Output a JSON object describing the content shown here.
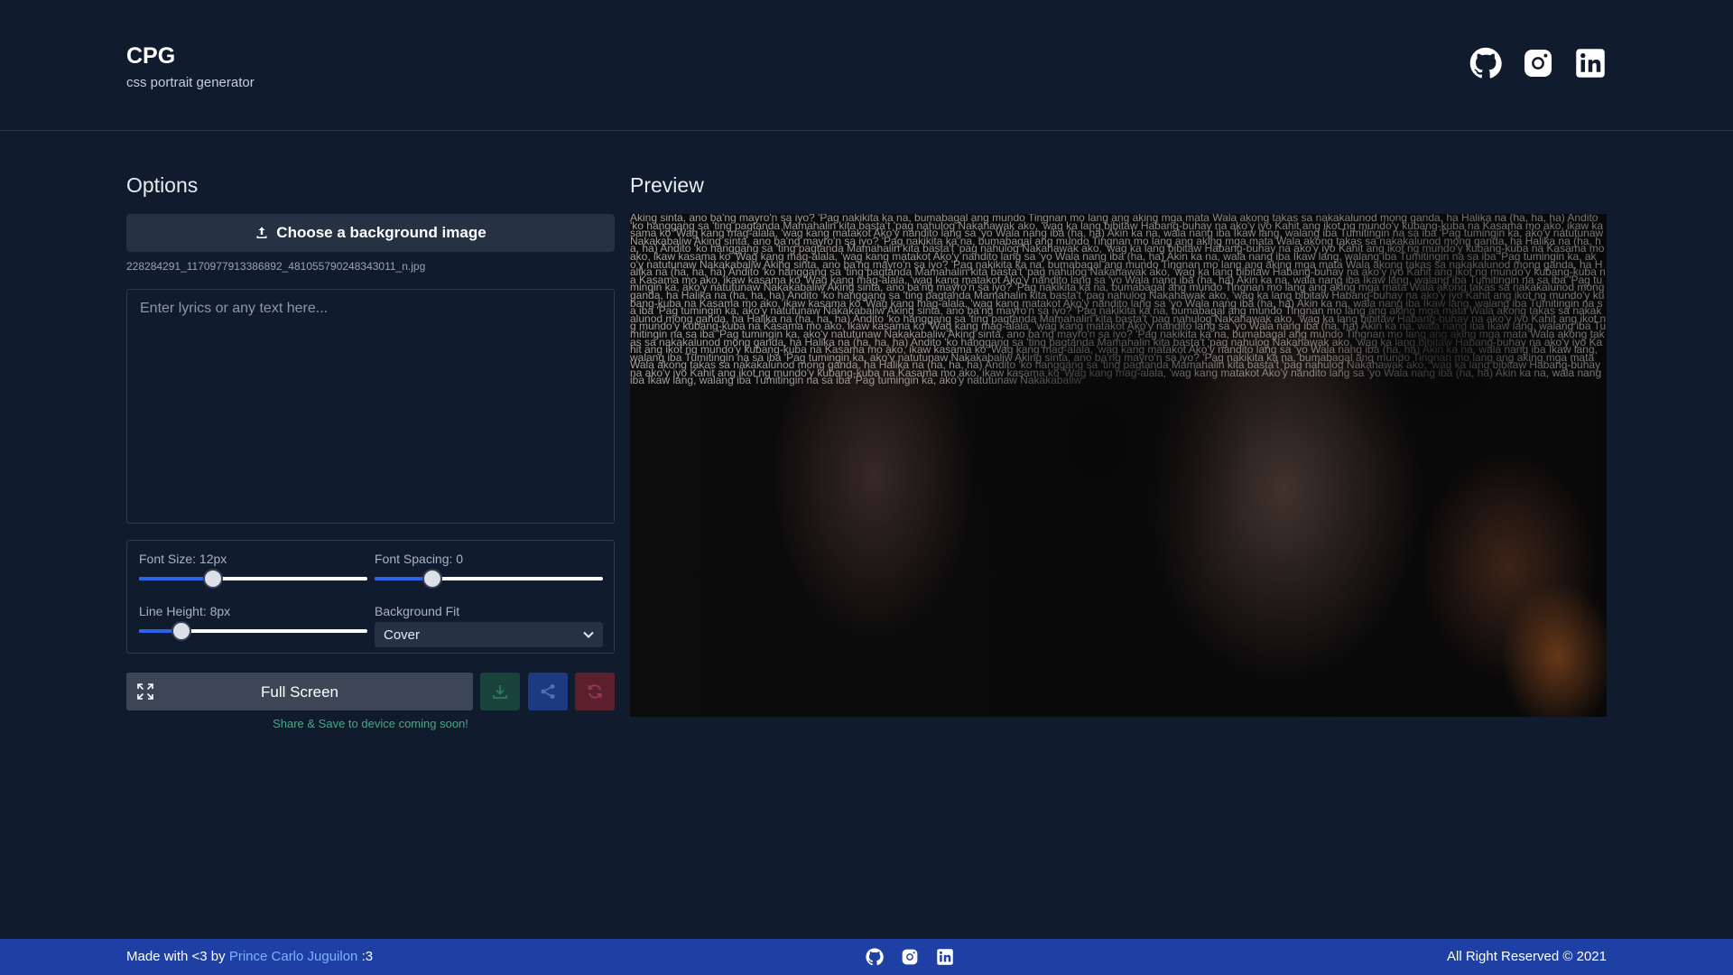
{
  "header": {
    "title": "CPG",
    "subtitle": "css portrait generator",
    "social_icons": [
      "github-icon",
      "instagram-icon",
      "linkedin-icon"
    ]
  },
  "options": {
    "section_title": "Options",
    "upload_label": "Choose a background image",
    "file_name": "228284291_1170977913386892_481055790248343011_n.jpg",
    "lyrics_placeholder": "Enter lyrics or any text here...",
    "lyrics_value": "",
    "font_size_label": "Font Size: 12px",
    "font_size_level": 0.32,
    "font_spacing_label": "Font Spacing: 0",
    "font_spacing_level": 0.25,
    "line_height_label": "Line Height: 8px",
    "line_height_level": 0.18,
    "background_fit_label": "Background Fit",
    "background_fit_value": "Cover",
    "fullscreen_label": "Full Screen",
    "coming_soon": "Share & Save to device coming soon!"
  },
  "preview": {
    "section_title": "Preview",
    "text": "Aking sinta, ano ba'ng mayro'n sa iyo? 'Pag nakikita ka na, bumabagal ang mundo Tingnan mo lang ang aking mga mata Wala akong takas sa nakakalunod mong ganda, ha Halika na (ha, ha, ha) Andito 'ko hanggang sa 'ting pagtanda Mamahalin kita basta't 'pag nahulog Nakahawak ako, 'wag ka lang bibitaw Habang-buhay na ako'y iyo Kahit ang ikot ng mundo'y kubang-kuba na Kasama mo ako, ikaw kasama ko 'Wag kang mag-alala, 'wag kang matakot Ako'y nandito lang sa 'yo Wala nang iba (ha, ha) Akin ka na, wala nang iba Ikaw lang, walang iba Tumitingin na sa iba 'Pag tumingin ka, ako'y natutunaw Nakakabaliw Aking sinta, ano ba'ng mayro'n sa iyo? 'Pag nakikita ka na, bumabagal ang mundo Tingnan mo lang ang aking mga mata Wala akong takas sa nakakalunod mong ganda, ha Halika na (ha, ha, ha) Andito 'ko hanggang sa 'ting pagtanda Mamahalin kita basta't 'pag nahulog Nakahawak ako, 'wag ka lang bibitaw Habang-buhay na ako'y iyo Kahit ang ikot ng mundo'y kubang-kuba na Kasama mo ako, ikaw kasama ko 'Wag kang mag-alala, 'wag kang matakot Ako'y nandito lang sa 'yo Wala nang iba (ha, ha) Akin ka na, wala nang iba Ikaw lang, walang iba Tumitingin na sa iba 'Pag tumingin ka, ako'y natutunaw Nakakabaliw Aking sinta, ano ba'ng mayro'n sa iyo? 'Pag nakikita ka na, bumabagal ang mundo Tingnan mo lang ang aking mga mata Wala akong takas sa nakakalunod mong ganda, ha Halika na (ha, ha, ha) Andito 'ko hanggang sa 'ting pagtanda Mamahalin kita basta't 'pag nahulog Nakahawak ako, 'wag ka lang bibitaw Habang-buhay na ako'y iyo Kahit ang ikot ng mundo'y kubang-kuba na Kasama mo ako, ikaw kasama ko 'Wag kang mag-alala, 'wag kang matakot Ako'y nandito lang sa 'yo Wala nang iba (ha, ha) Akin ka na, wala nang iba Ikaw lang, walang iba Tumitingin na sa iba 'Pag tumingin ka, ako'y natutunaw Nakakabaliw Aking sinta, ano ba'ng mayro'n sa iyo? 'Pag nakikita ka na, bumabagal ang mundo Tingnan mo lang ang aking mga mata Wala akong takas sa nakakalunod mong ganda, ha Halika na (ha, ha, ha) Andito 'ko hanggang sa 'ting pagtanda Mamahalin kita basta't 'pag nahulog Nakahawak ako, 'wag ka lang bibitaw Habang-buhay na ako'y iyo Kahit ang ikot ng mundo'y kubang-kuba na Kasama mo ako, ikaw kasama ko 'Wag kang mag-alala, 'wag kang matakot Ako'y nandito lang sa 'yo Wala nang iba (ha, ha) Akin ka na, wala nang iba Ikaw lang, walang iba Tumitingin na sa iba 'Pag tumingin ka, ako'y natutunaw Nakakabaliw Aking sinta, ano ba'ng mayro'n sa iyo? 'Pag nakikita ka na, bumabagal ang mundo Tingnan mo lang ang aking mga mata Wala akong takas sa nakakalunod mong ganda, ha Halika na (ha, ha, ha) Andito 'ko hanggang sa 'ting pagtanda Mamahalin kita basta't 'pag nahulog Nakahawak ako, 'wag ka lang bibitaw Habang-buhay na ako'y iyo Kahit ang ikot ng mundo'y kubang-kuba na Kasama mo ako, ikaw kasama ko 'Wag kang mag-alala, 'wag kang matakot Ako'y nandito lang sa 'yo Wala nang iba (ha, ha) Akin ka na, wala nang iba Ikaw lang, walang iba Tumitingin na sa iba 'Pag tumingin ka, ako'y natutunaw Nakakabaliw Aking sinta, ano ba'ng mayro'n sa iyo? 'Pag nakikita ka na, bumabagal ang mundo Tingnan mo lang ang aking mga mata Wala akong takas sa nakakalunod mong ganda, ha Halika na (ha, ha, ha) Andito 'ko hanggang sa 'ting pagtanda Mamahalin kita basta't 'pag nahulog Nakahawak ako, 'wag ka lang bibitaw Habang-buhay na ako'y iyo Kahit ang ikot ng mundo'y kubang-kuba na Kasama mo ako, ikaw kasama ko 'Wag kang mag-alala, 'wag kang matakot Ako'y nandito lang sa 'yo Wala nang iba (ha, ha) Akin ka na, wala nang iba Ikaw lang, walang iba Tumitingin na sa iba 'Pag tumingin ka, ako'y natutunaw Nakakabaliw Aking sinta, ano ba'ng mayro'n sa iyo? 'Pag nakikita ka na, bumabagal ang mundo Tingnan mo lang ang aking mga mata Wala akong takas sa nakakalunod mong ganda, ha Halika na (ha, ha, ha) Andito 'ko hanggang sa 'ting pagtanda Mamahalin kita basta't 'pag nahulog Nakahawak ako, 'wag ka lang bibitaw Habang-buhay na ako'y iyo Kahit ang ikot ng mundo'y kubang-kuba na Kasama mo ako, ikaw kasama ko 'Wag kang mag-alala, 'wag kang matakot Ako'y nandito lang sa 'yo Wala nang iba (ha, ha) Akin ka na, wala nang iba Ikaw lang, walang iba Tumitingin na sa iba 'Pag tumingin ka, ako'y natutunaw Nakakabaliw"
  },
  "footer": {
    "made_with": "Made with <3 by",
    "author": "Prince Carlo Juguilon",
    "suffix": ":3",
    "rights": "All Right Reserved © 2021"
  },
  "colors": {
    "background": "#111b2e",
    "footer": "#1e3fa3",
    "accent": "#2b63e8",
    "download": "#19423a",
    "share": "#1d3a80",
    "refresh": "#5c1f2c",
    "notice": "#3fae7b"
  }
}
